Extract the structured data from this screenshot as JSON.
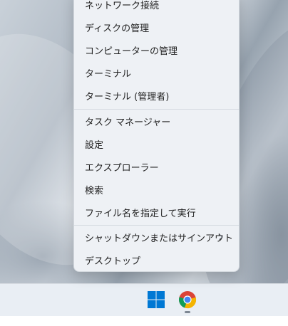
{
  "context_menu": {
    "items": [
      {
        "label": "ネットワーク接続"
      },
      {
        "label": "ディスクの管理"
      },
      {
        "label": "コンピューターの管理"
      },
      {
        "label": "ターミナル"
      },
      {
        "label": "ターミナル (管理者)"
      },
      {
        "label": "タスク マネージャー"
      },
      {
        "label": "設定"
      },
      {
        "label": "エクスプローラー"
      },
      {
        "label": "検索"
      },
      {
        "label": "ファイル名を指定して実行"
      },
      {
        "label": "シャットダウンまたはサインアウト",
        "submenu_icon": "chevron-right-icon"
      },
      {
        "label": "デスクトップ"
      }
    ]
  },
  "taskbar": {
    "icons": [
      {
        "name": "windows-start-icon",
        "color": "#0078d4"
      },
      {
        "name": "chrome-icon",
        "running": true
      }
    ]
  }
}
